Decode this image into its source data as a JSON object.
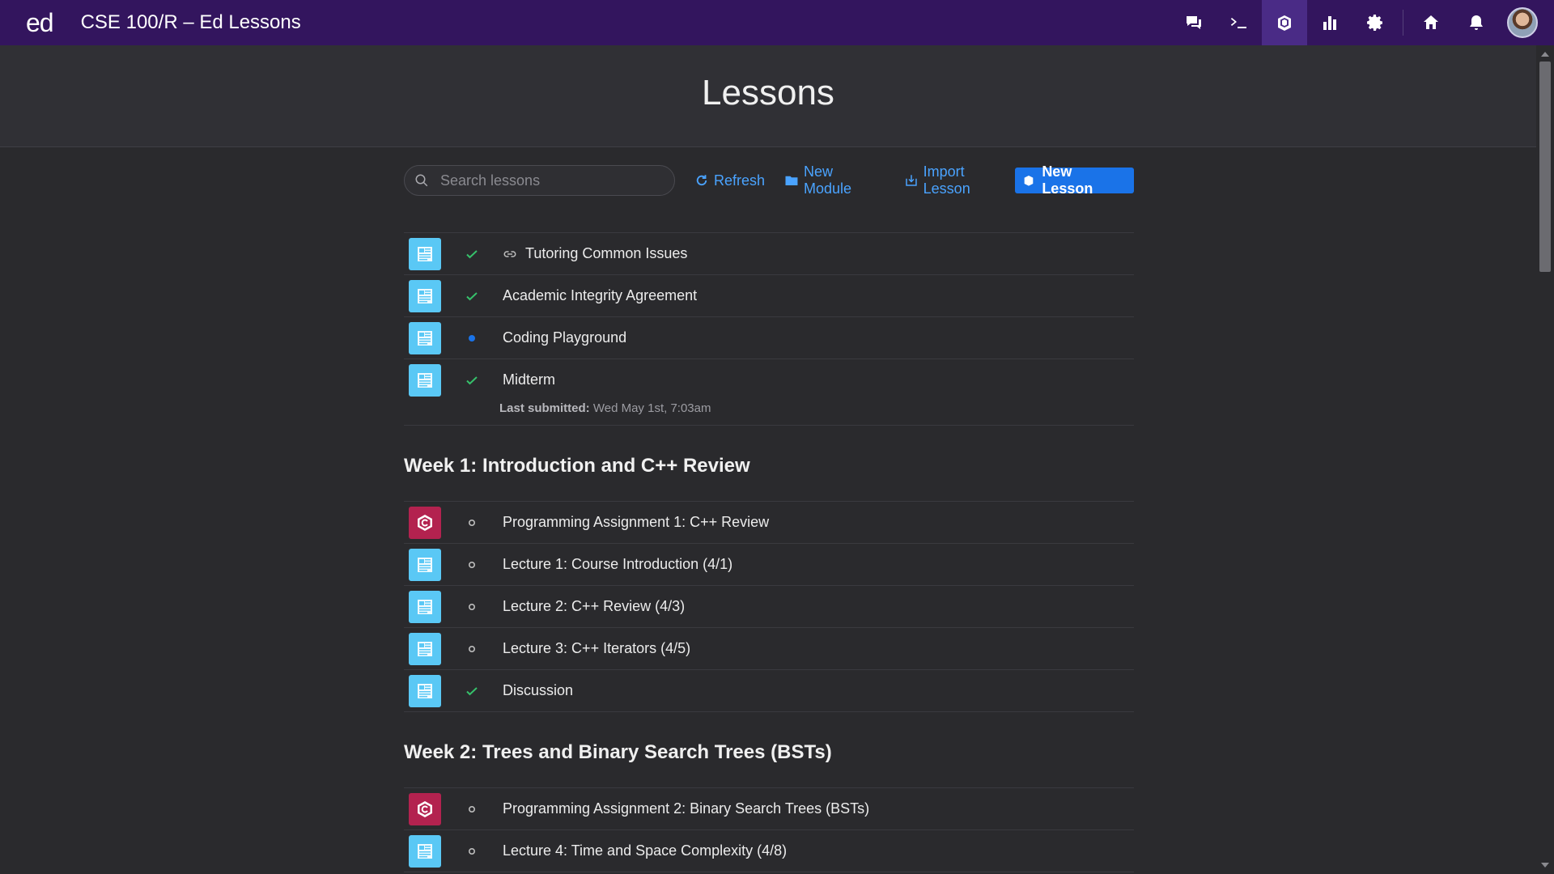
{
  "app": {
    "logo": "ed",
    "course_title": "CSE 100/R – Ed Lessons"
  },
  "topbar_icons": [
    "chat-icon",
    "terminal-icon",
    "lessons-icon",
    "analytics-icon",
    "settings-icon",
    "home-icon",
    "bell-icon",
    "avatar"
  ],
  "page": {
    "title": "Lessons"
  },
  "toolbar": {
    "search_placeholder": "Search lessons",
    "refresh": "Refresh",
    "new_module": "New Module",
    "import_lesson": "Import Lesson",
    "new_lesson": "New Lesson"
  },
  "colors": {
    "topbar": "#33155e",
    "accent": "#1a73e8",
    "link": "#4aa3ff",
    "check": "#36c16b",
    "doc_icon": "#5ac8f5",
    "code_icon": "#b3224f"
  },
  "ungrouped": [
    {
      "type": "doc",
      "status": "check",
      "title": "Tutoring Common Issues",
      "link": true
    },
    {
      "type": "doc",
      "status": "check",
      "title": "Academic Integrity Agreement"
    },
    {
      "type": "doc",
      "status": "dot",
      "title": "Coding Playground"
    },
    {
      "type": "doc",
      "status": "check",
      "title": "Midterm",
      "meta_label": "Last submitted:",
      "meta_value": " Wed May 1st, 7:03am"
    }
  ],
  "modules": [
    {
      "title": "Week 1: Introduction and C++ Review",
      "lessons": [
        {
          "type": "code",
          "status": "circle",
          "title": "Programming Assignment 1: C++ Review"
        },
        {
          "type": "doc",
          "status": "circle",
          "title": "Lecture 1: Course Introduction (4/1)"
        },
        {
          "type": "doc",
          "status": "circle",
          "title": "Lecture 2: C++ Review (4/3)"
        },
        {
          "type": "doc",
          "status": "circle",
          "title": "Lecture 3: C++ Iterators (4/5)"
        },
        {
          "type": "doc",
          "status": "check",
          "title": "Discussion"
        }
      ]
    },
    {
      "title": "Week 2: Trees and Binary Search Trees (BSTs)",
      "lessons": [
        {
          "type": "code",
          "status": "circle",
          "title": "Programming Assignment 2: Binary Search Trees (BSTs)"
        },
        {
          "type": "doc",
          "status": "circle",
          "title": "Lecture 4: Time and Space Complexity (4/8)"
        }
      ]
    }
  ]
}
